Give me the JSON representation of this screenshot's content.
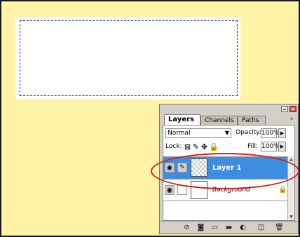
{
  "panel": {
    "tabs": [
      {
        "label": "Layers",
        "active": true
      },
      {
        "label": "Channels",
        "active": false
      },
      {
        "label": "Paths",
        "active": false
      }
    ],
    "tab_menu": "»",
    "blend_mode": "Normal",
    "opacity_label": "Opacity:",
    "opacity_value": "100%",
    "lock_label": "Lock:",
    "fill_label": "Fill:",
    "fill_value": "100%",
    "layers": [
      {
        "name": "Layer 1",
        "selected": true,
        "visible": true
      },
      {
        "name": "Background",
        "selected": false,
        "visible": true,
        "locked": true
      }
    ],
    "icons": {
      "minimize": "minimize-icon",
      "close": "close-icon",
      "eye": "eye-icon",
      "brush": "brush-icon",
      "lock": "lock-icon",
      "link": "link-icon",
      "style": "layer-style-icon",
      "mask": "mask-icon",
      "folder": "folder-icon",
      "adjust": "adjustment-layer-icon",
      "new": "new-layer-icon",
      "trash": "trash-icon"
    }
  },
  "colors": {
    "canvas_bg": "#fff3a8",
    "selection": "#3d8ee0",
    "highlight": "#d02020",
    "marquee": "#2a2a9a"
  }
}
